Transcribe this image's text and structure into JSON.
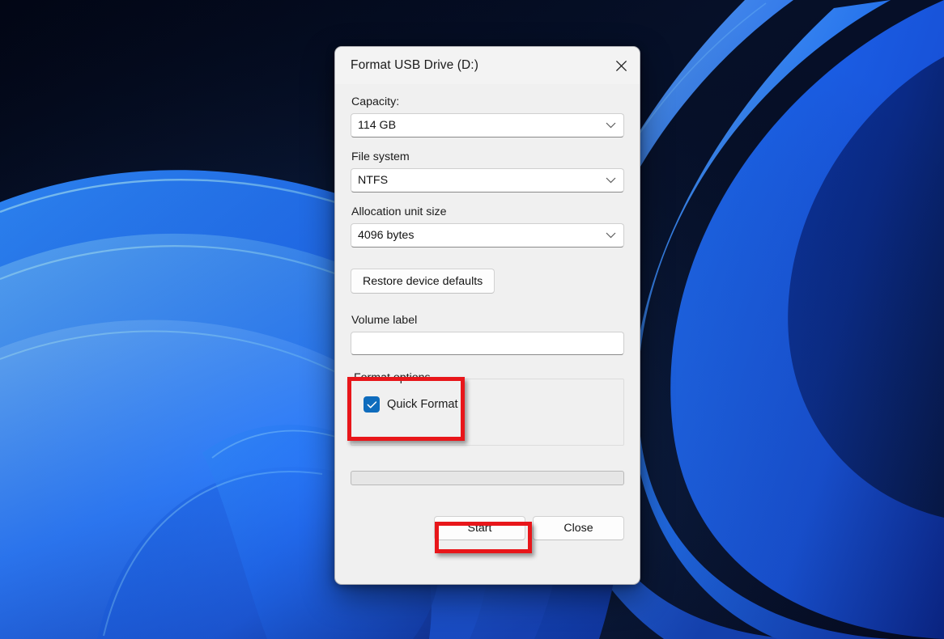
{
  "desktop": {
    "wallpaper_name": "windows-bloom-wallpaper",
    "colors": {
      "deep_navy": "#04091b",
      "dark_blue": "#0a1940",
      "mid_blue": "#1149c8",
      "bright_blue": "#1f6ef5",
      "light_blue": "#3f93ff",
      "cyan_edge": "#79d3ff"
    }
  },
  "dialog": {
    "title": "Format USB Drive (D:)",
    "close_icon": "close-icon",
    "capacity": {
      "label": "Capacity:",
      "value": "114 GB",
      "chevron_icon": "chevron-down-icon"
    },
    "file_system": {
      "label": "File system",
      "value": "NTFS",
      "chevron_icon": "chevron-down-icon"
    },
    "allocation_unit_size": {
      "label": "Allocation unit size",
      "value": "4096 bytes",
      "chevron_icon": "chevron-down-icon"
    },
    "restore_defaults_label": "Restore device defaults",
    "volume_label": {
      "label": "Volume label",
      "value": "",
      "placeholder": ""
    },
    "format_options": {
      "legend": "Format options",
      "quick_format": {
        "label": "Quick Format",
        "checked": true,
        "check_icon": "checkmark-icon",
        "accent_color": "#0f6cbd"
      }
    },
    "progress": {
      "value": 0,
      "max": 100
    },
    "buttons": {
      "start": "Start",
      "close": "Close"
    }
  },
  "annotations": {
    "color": "#e8161a",
    "boxes": [
      {
        "name": "format-options-highlight",
        "target": "Format options / Quick Format"
      },
      {
        "name": "start-button-highlight",
        "target": "Start"
      }
    ]
  }
}
